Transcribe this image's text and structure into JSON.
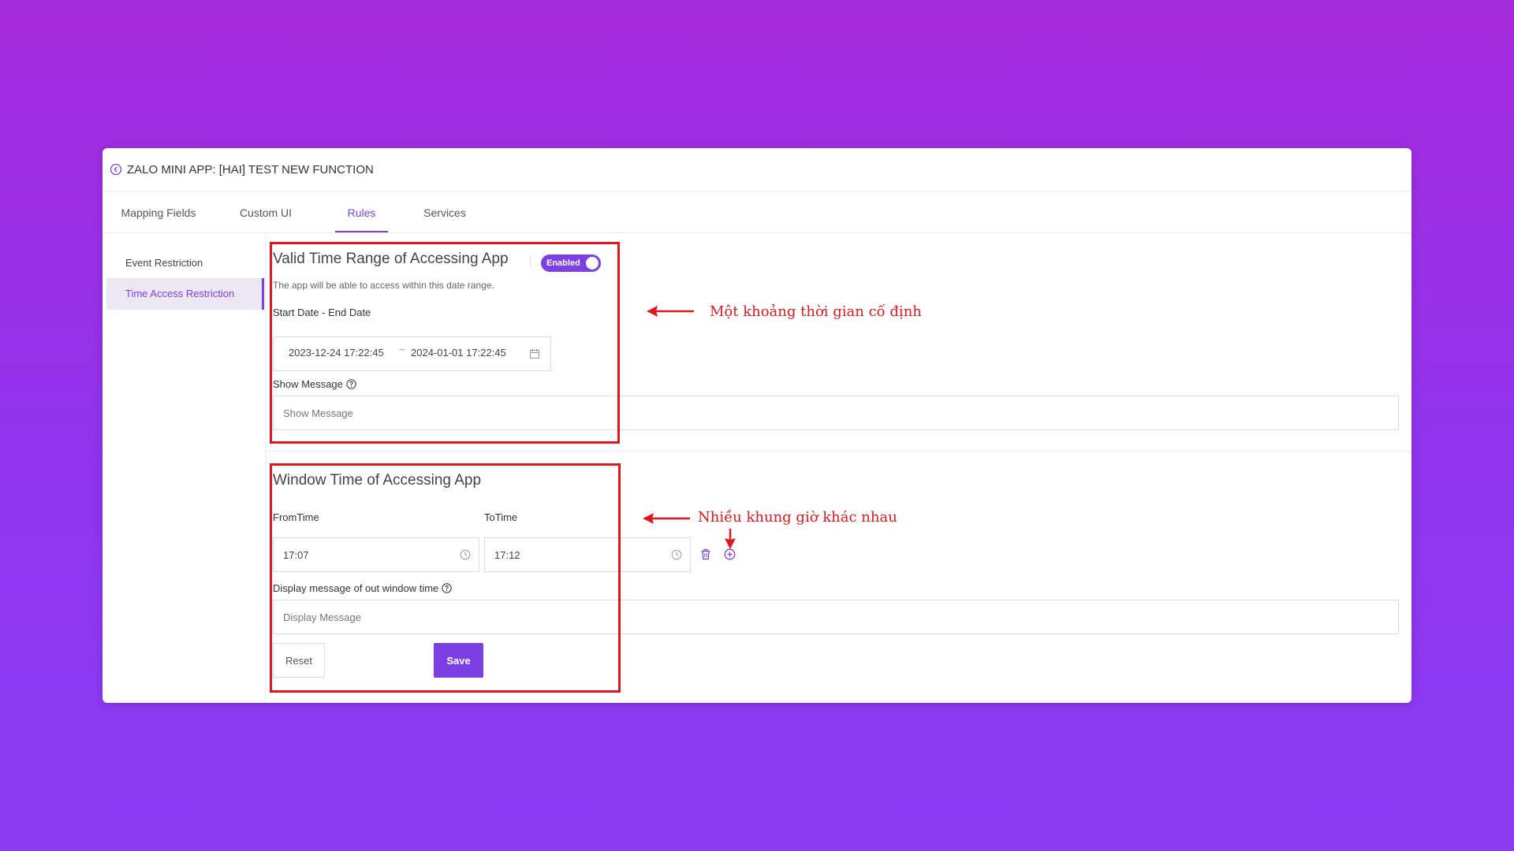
{
  "header": {
    "title": "ZALO MINI APP: [HAI] TEST NEW FUNCTION"
  },
  "tabs": [
    {
      "label": "Mapping Fields"
    },
    {
      "label": "Custom UI"
    },
    {
      "label": "Rules"
    },
    {
      "label": "Services"
    }
  ],
  "active_tab": "Rules",
  "sidebar": {
    "items": [
      {
        "label": "Event Restriction"
      },
      {
        "label": "Time Access Restriction"
      }
    ],
    "active": "Time Access Restriction"
  },
  "valid_range": {
    "title": "Valid Time Range of Accessing App",
    "toggle_label": "Enabled",
    "description": "The app will be able to access within this date range.",
    "date_label": "Start Date - End Date",
    "start_date": "2023-12-24 17:22:45",
    "separator": "~",
    "end_date": "2024-01-01 17:22:45",
    "message_label": "Show Message",
    "message_placeholder": "Show Message"
  },
  "window_time": {
    "title": "Window Time of Accessing App",
    "from_label": "FromTime",
    "to_label": "ToTime",
    "from_value": "17:07",
    "to_value": "17:12",
    "message_label": "Display message of out window time",
    "message_placeholder": "Display Message"
  },
  "buttons": {
    "reset": "Reset",
    "save": "Save"
  },
  "annotations": {
    "fixed_range": "Một khoảng thời gian cố định",
    "multiple_windows": "Nhiều khung giờ khác nhau"
  },
  "colors": {
    "accent": "#7b3fe4",
    "annotation": "#e0171c"
  }
}
